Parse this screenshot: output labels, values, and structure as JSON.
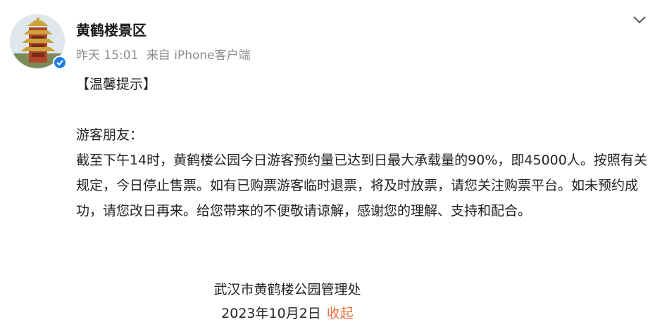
{
  "author": {
    "name": "黄鹤楼景区",
    "verified": true,
    "verified_color": "#1f7ee8"
  },
  "meta": {
    "time": "昨天 15:01",
    "source": "来自 iPhone客户端"
  },
  "post": {
    "notice": "【温馨提示】",
    "greeting": "游客朋友：",
    "body": "截至下午14时，黄鹤楼公园今日游客预约量已达到日最大承载量的90%，即45000人。按照有关规定，今日停止售票。如有已购票游客临时退票，将及时放票，请您关注购票平台。如未预约成功，请您改日再来。给您带来的不便敬请谅解，感谢您的理解、支持和配合。",
    "signature": "武汉市黄鹤楼公园管理处",
    "date": "2023年10月2日",
    "collapse_label": "收起"
  },
  "icons": {
    "menu": "chevron-down-icon",
    "badge": "verified-badge-icon",
    "avatar": "yellow-crane-tower-avatar"
  },
  "colors": {
    "accent_link": "#eb7340",
    "meta_text": "#8c8c8c"
  }
}
